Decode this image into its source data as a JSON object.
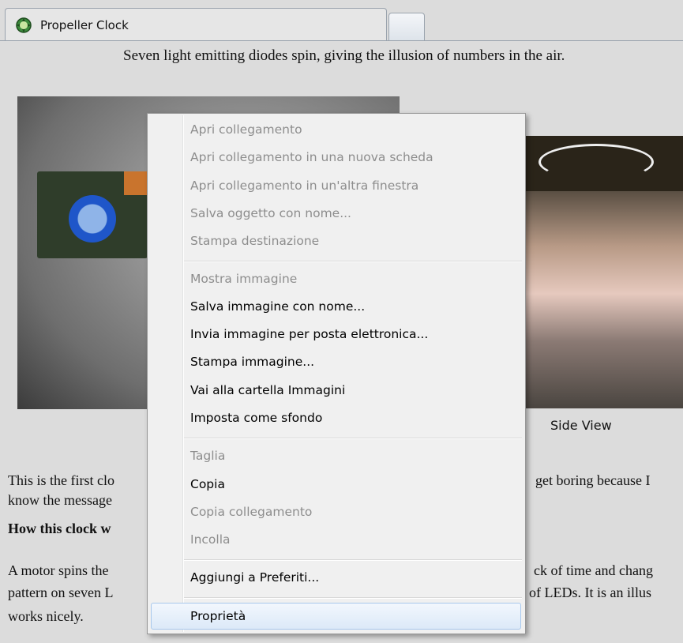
{
  "tabs": {
    "active_title": "Propeller Clock",
    "new_tab": ""
  },
  "page": {
    "caption": "Seven light emitting diodes spin, giving the illusion of numbers in the air.",
    "side_view_label": "Side View",
    "para1_line1_left": "This is the first clo",
    "para1_line1_right": "get boring because I",
    "para1_line2_left": "know the message",
    "heading_left": "How this clock w",
    "para2_line1_left": "A motor spins the",
    "para2_line1_right": "ck of time and chang",
    "para2_line2_left": "pattern on seven L",
    "para2_line2_right": "of LEDs. It is an illus",
    "para2_line3_left": "works nicely."
  },
  "context_menu": {
    "items": [
      {
        "label": "Apri collegamento",
        "enabled": false
      },
      {
        "label": "Apri collegamento in una nuova scheda",
        "enabled": false
      },
      {
        "label": "Apri collegamento in un'altra finestra",
        "enabled": false
      },
      {
        "label": "Salva oggetto con nome...",
        "enabled": false
      },
      {
        "label": "Stampa destinazione",
        "enabled": false
      },
      {
        "label": "Mostra immagine",
        "enabled": false
      },
      {
        "label": "Salva immagine con nome...",
        "enabled": true
      },
      {
        "label": "Invia immagine per posta elettronica...",
        "enabled": true
      },
      {
        "label": "Stampa immagine...",
        "enabled": true
      },
      {
        "label": "Vai alla cartella Immagini",
        "enabled": true
      },
      {
        "label": "Imposta come sfondo",
        "enabled": true
      },
      {
        "label": "Taglia",
        "enabled": false
      },
      {
        "label": "Copia",
        "enabled": true
      },
      {
        "label": "Copia collegamento",
        "enabled": false
      },
      {
        "label": "Incolla",
        "enabled": false
      },
      {
        "label": "Aggiungi a Preferiti...",
        "enabled": true
      },
      {
        "label": "Proprietà",
        "enabled": true,
        "highlighted": true
      }
    ]
  },
  "colors": {
    "page_bg": "#dcdcdc",
    "menu_bg": "#f0f0f0",
    "disabled_text": "#8d8d8d",
    "highlight_border": "#a8c8ec"
  }
}
